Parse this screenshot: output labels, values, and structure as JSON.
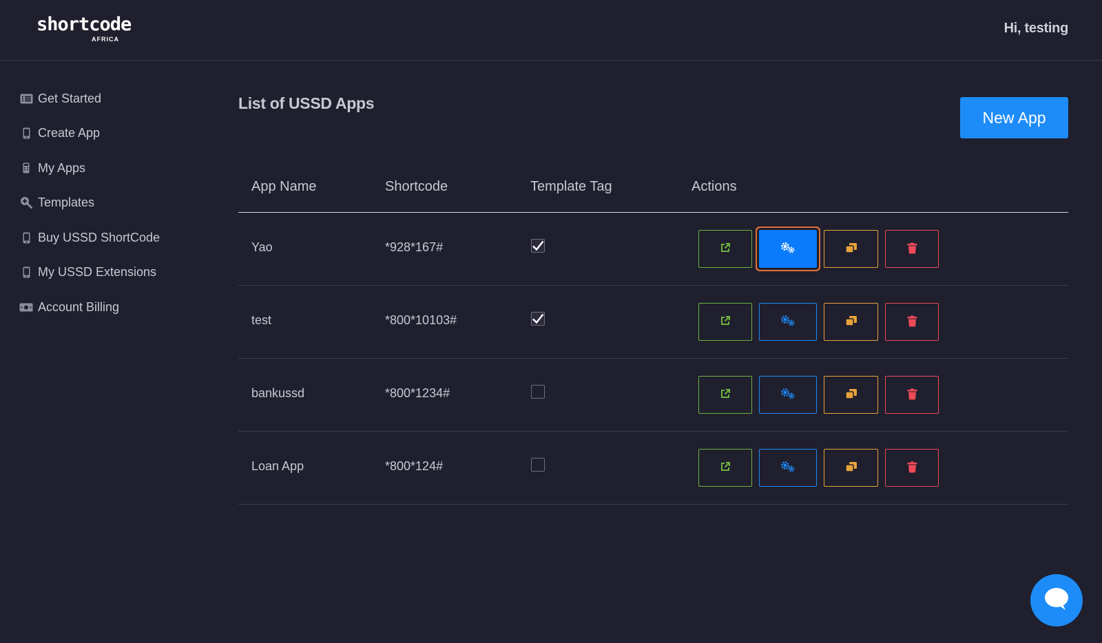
{
  "brand": {
    "name": "shortcode",
    "sub": "AFRICA"
  },
  "header": {
    "greeting": "Hi, testing"
  },
  "sidebar": {
    "items": [
      {
        "label": "Get Started",
        "icon": "list-icon"
      },
      {
        "label": "Create App",
        "icon": "phone-icon"
      },
      {
        "label": "My Apps",
        "icon": "phone-keypad-icon"
      },
      {
        "label": "Templates",
        "icon": "search-zoom-icon"
      },
      {
        "label": "Buy USSD ShortCode",
        "icon": "phone-icon"
      },
      {
        "label": "My USSD Extensions",
        "icon": "phone-icon"
      },
      {
        "label": "Account Billing",
        "icon": "money-icon"
      }
    ]
  },
  "main": {
    "title": "List of USSD Apps",
    "new_app_label": "New App",
    "columns": [
      "App Name",
      "Shortcode",
      "Template Tag",
      "Actions"
    ],
    "rows": [
      {
        "name": "Yao",
        "shortcode": "*928*167#",
        "template": true
      },
      {
        "name": "test",
        "shortcode": "*800*10103#",
        "template": true
      },
      {
        "name": "bankussd",
        "shortcode": "*800*1234#",
        "template": false
      },
      {
        "name": "Loan App",
        "shortcode": "*800*124#",
        "template": false
      }
    ],
    "actions": [
      "open-external-icon",
      "gears-icon",
      "copy-icon",
      "trash-icon"
    ]
  },
  "colors": {
    "background": "#1f1f2e",
    "primary": "#1d8cf8",
    "open": "#6db33f",
    "copy": "#e8a33a",
    "delete": "#ef4a58",
    "focus_ring": "#e0703a"
  }
}
